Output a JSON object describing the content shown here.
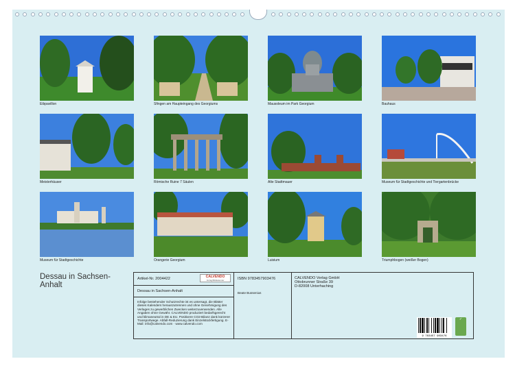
{
  "calendar": {
    "title": "Dessau in Sachsen-Anhalt"
  },
  "photos": [
    {
      "caption": "Eibpavillon"
    },
    {
      "caption": "Sfingen am Haupteingang des Georgiums"
    },
    {
      "caption": "Mausoleum im Park Georgium"
    },
    {
      "caption": "Bauhaus"
    },
    {
      "caption": "Meisterhäuser"
    },
    {
      "caption": "Römische Ruine 7 Säulen"
    },
    {
      "caption": "Alte Stadtmauer"
    },
    {
      "caption": "Museum für Stadtgeschichte und Tiergartenbrücke"
    },
    {
      "caption": "Museum für Stadtgeschichte"
    },
    {
      "caption": "Orangerie Georgium"
    },
    {
      "caption": "Luisium"
    },
    {
      "caption": "Triumphbogen (weißer Bogen)"
    }
  ],
  "info": {
    "article_label": "Artikel-Nr. 2004422",
    "logo_text": "CALVENDO",
    "logo_sub": "Verlag/Bildkalender",
    "title_repeat": "Dessau in Sachsen-Anhalt",
    "isbn": "ISBN 9783457903476",
    "author": "Beate Bussenius",
    "publisher_line1": "CALVENDO Verlag GmbH",
    "publisher_line2": "Ottobrunner Straße 39",
    "publisher_line3": "D-82008 Unterhaching",
    "legal_text": "Infolge bestehender Schutzrechte ist es untersagt, die Blätter dieses Kalenders herauszutrennen und ohne Genehmigung des Verlages zu gewerblichen Zwecken weiterzuverwenden. Alle Angaben ohne Gewähr. CALVENDO produziert bedarfsgerecht und klimaneutral in DE & EU. Positivere CO2-Bilanz dank kürzerer Transportwege. Abfall-Reduzierung dank Einzelstückfertigung. E-Mail: info@calvendo.com · www.calvendo.com",
    "barcode_number": "9 783457 903476"
  }
}
